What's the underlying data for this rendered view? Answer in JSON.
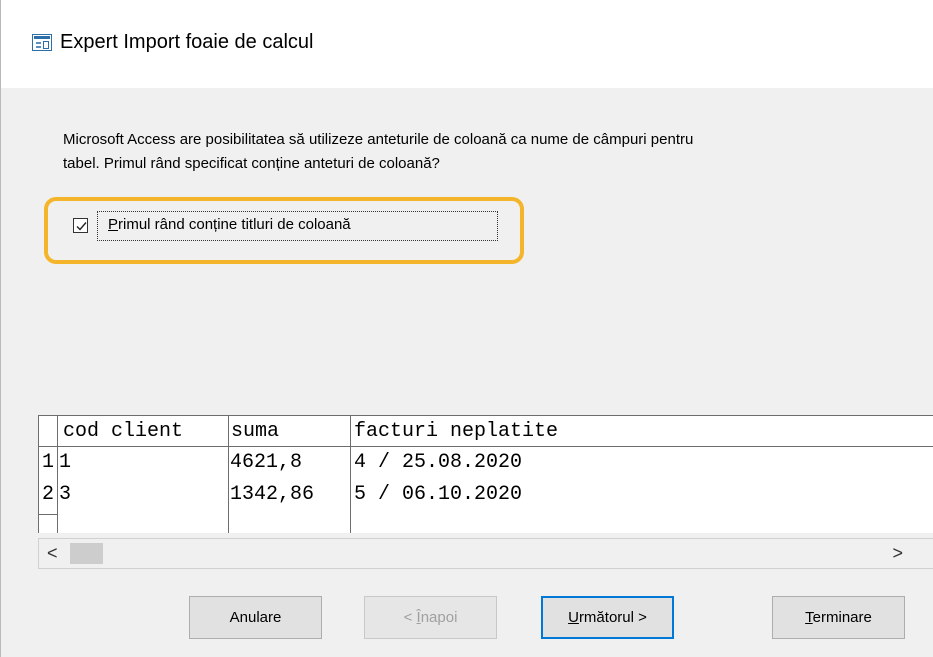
{
  "window": {
    "title": "Expert Import foaie de calcul",
    "icon": "spreadsheet-import-icon"
  },
  "description": {
    "line1": "Microsoft Access are posibilitatea să utilizeze anteturile de coloană ca nume de câmpuri pentru",
    "line2": "tabel. Primul rând specificat conține anteturi de coloană?"
  },
  "checkbox": {
    "label_first": "P",
    "label_rest": "rimul rând conține titluri de coloană",
    "checked": true
  },
  "highlight_color": "#f5b52b",
  "grid": {
    "headers": [
      "cod client",
      "suma",
      "facturi neplatite"
    ],
    "rows": [
      {
        "num": "1",
        "cells": [
          "1",
          "4621,8",
          "4 / 25.08.2020"
        ]
      },
      {
        "num": "2",
        "cells": [
          "3",
          "1342,86",
          "5 / 06.10.2020"
        ]
      }
    ]
  },
  "scrollbar": {
    "left_arrow": "<",
    "right_arrow": ">"
  },
  "buttons": {
    "cancel": "Anulare",
    "back_prefix": "< ",
    "back_u": "Î",
    "back_rest": "napoi",
    "next_u": "U",
    "next_rest": "rmătorul >",
    "finish_u": "T",
    "finish_rest": "erminare"
  }
}
